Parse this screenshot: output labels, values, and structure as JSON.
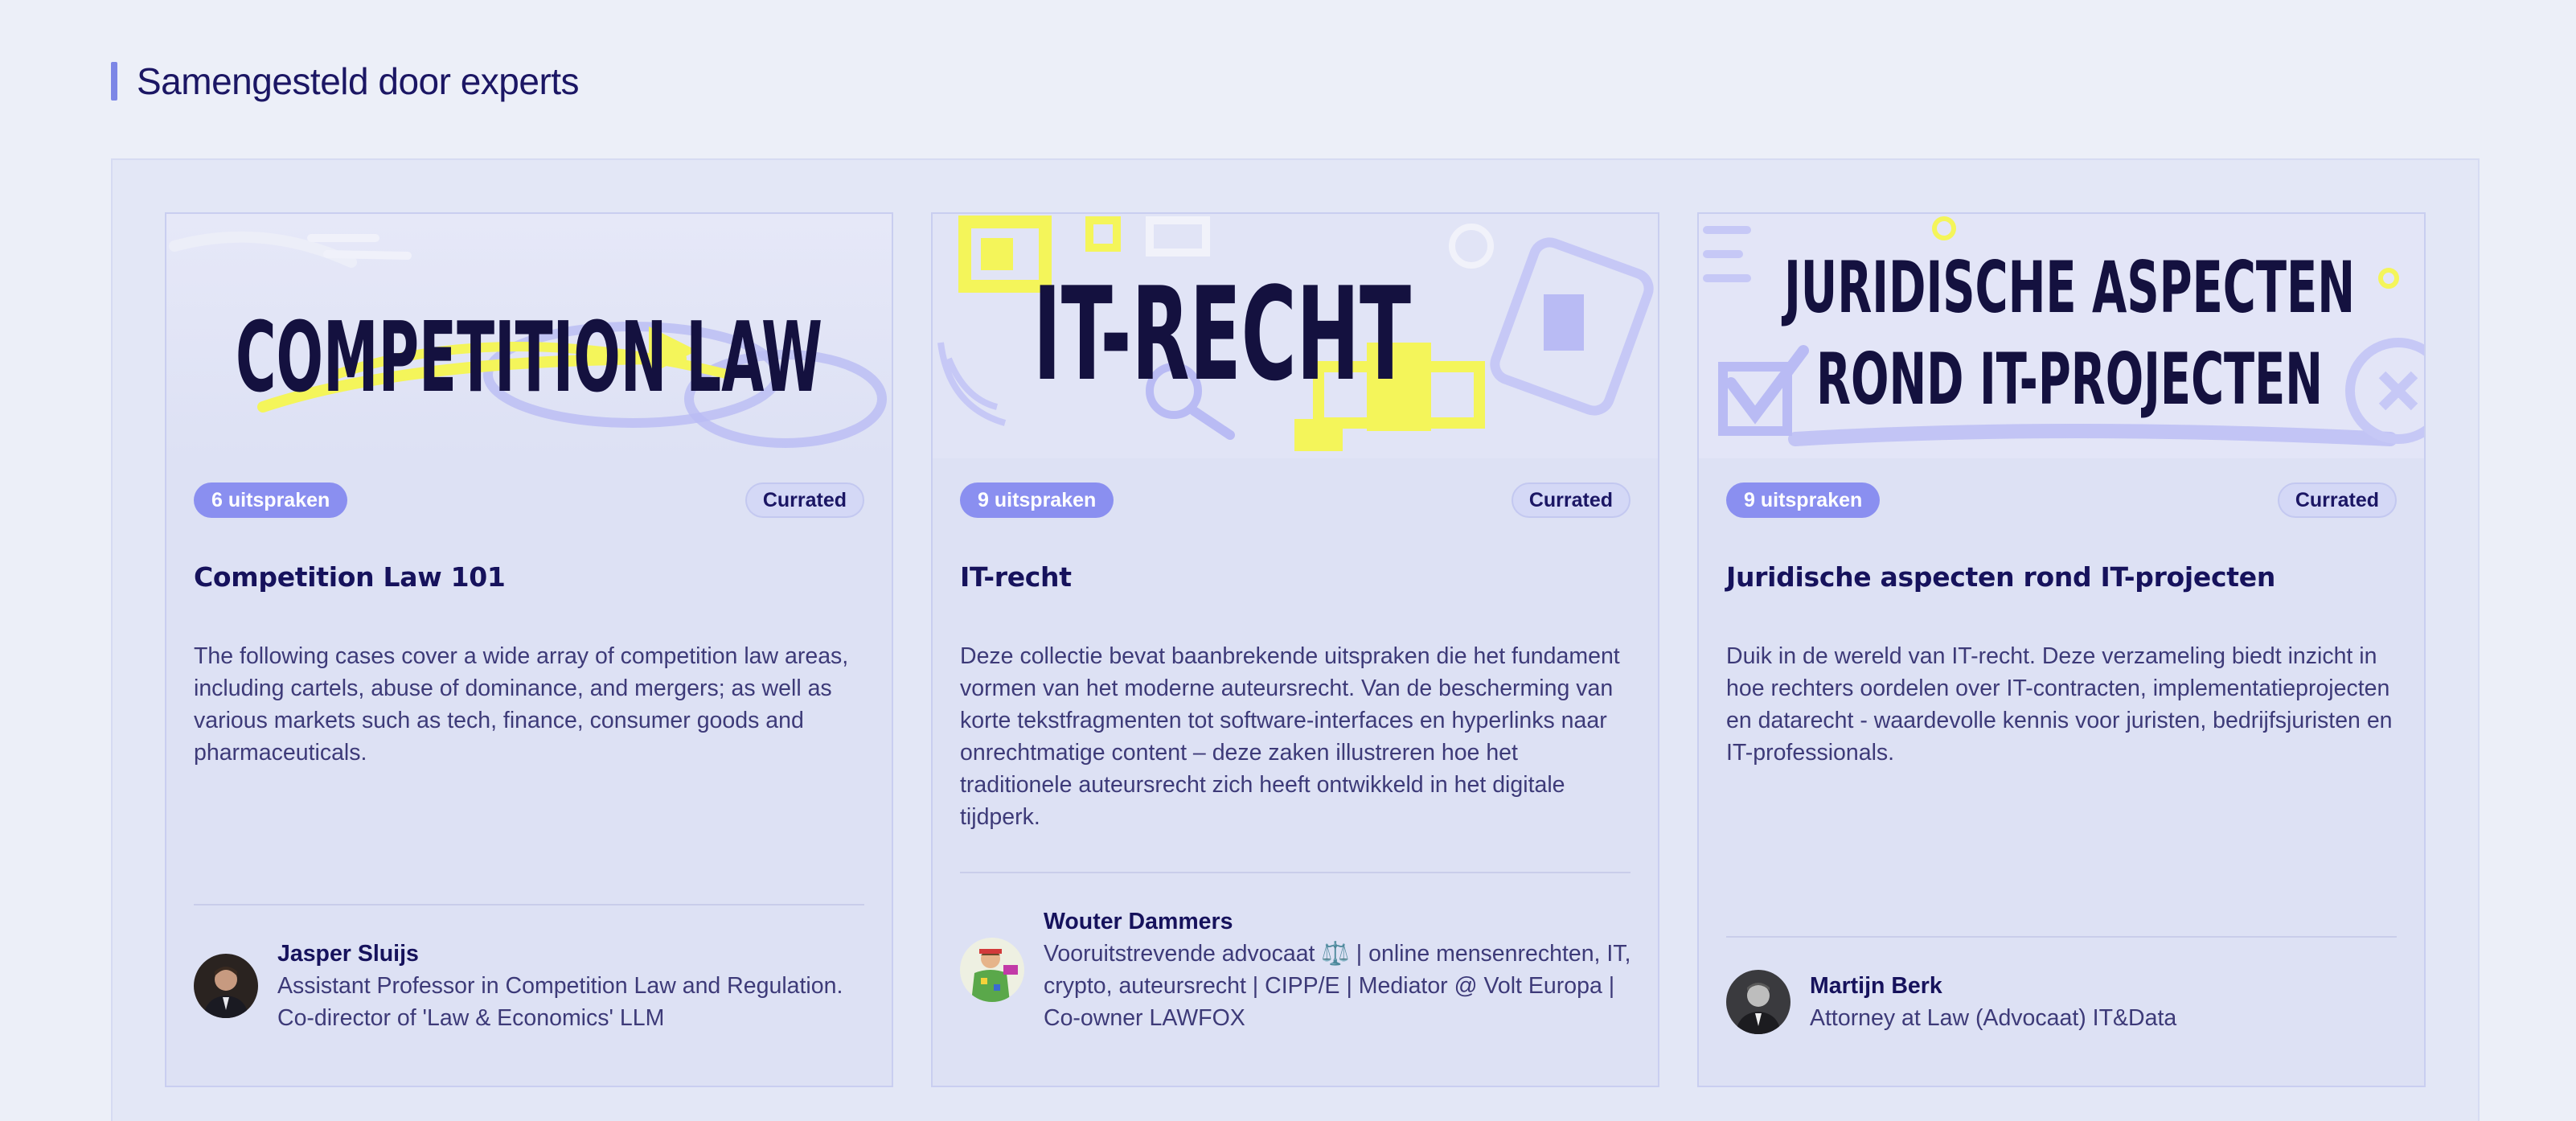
{
  "section": {
    "title": "Samengesteld door experts"
  },
  "cards": [
    {
      "banner_text": "COMPETITION LAW",
      "count": "6 uitspraken",
      "badge": "Currated",
      "title": "Competition Law 101",
      "description": "The following cases cover a wide array of competition law areas, including cartels, abuse of dominance, and mergers; as well as various markets such as tech, finance, consumer goods and pharmaceuticals.",
      "author": {
        "name": "Jasper Sluijs",
        "role": "Assistant Professor in Competition Law and Regulation. Co-director of 'Law & Economics' LLM"
      }
    },
    {
      "banner_text": "IT-RECHT",
      "count": "9 uitspraken",
      "badge": "Currated",
      "title": "IT-recht",
      "description": "Deze collectie bevat baanbrekende uitspraken die het fundament vormen van het moderne auteursrecht. Van de bescherming van korte tekstfragmenten tot software-interfaces en hyperlinks naar onrechtmatige content – deze zaken illustreren hoe het traditionele auteursrecht zich heeft ontwikkeld in het digitale tijdperk.",
      "author": {
        "name": "Wouter Dammers",
        "role": "Vooruitstrevende advocaat ⚖️ | online mensenrechten, IT, crypto, auteursrecht | CIPP/E | Mediator @ Volt Europa | Co-owner LAWFOX"
      }
    },
    {
      "banner_text": "JURIDISCHE ASPECTEN ROND IT-PROJECTEN",
      "banner_line1": "JURIDISCHE ASPECTEN",
      "banner_line2": "ROND IT-PROJECTEN",
      "count": "9 uitspraken",
      "badge": "Currated",
      "title": "Juridische aspecten rond IT-projecten",
      "description": "Duik in de wereld van IT-recht. Deze verzameling biedt inzicht in hoe rechters oordelen over IT-contracten, implementatieprojecten en datarecht - waardevolle kennis voor juristen, bedrijfsjuristen en IT-professionals.",
      "author": {
        "name": "Martijn Berk",
        "role": "Attorney at Law (Advocaat) IT&Data"
      }
    }
  ],
  "colors": {
    "page_bg": "#eceff8",
    "card_bg": "#dde1f4",
    "accent": "#8a8ff0",
    "title": "#16125c",
    "highlight_yellow": "#f4f55a",
    "doodle_lavender": "#b3b5f5"
  },
  "icons": {
    "banner1": "competition-law-doodle",
    "banner2": "it-recht-doodle",
    "banner3": "it-projecten-doodle"
  }
}
